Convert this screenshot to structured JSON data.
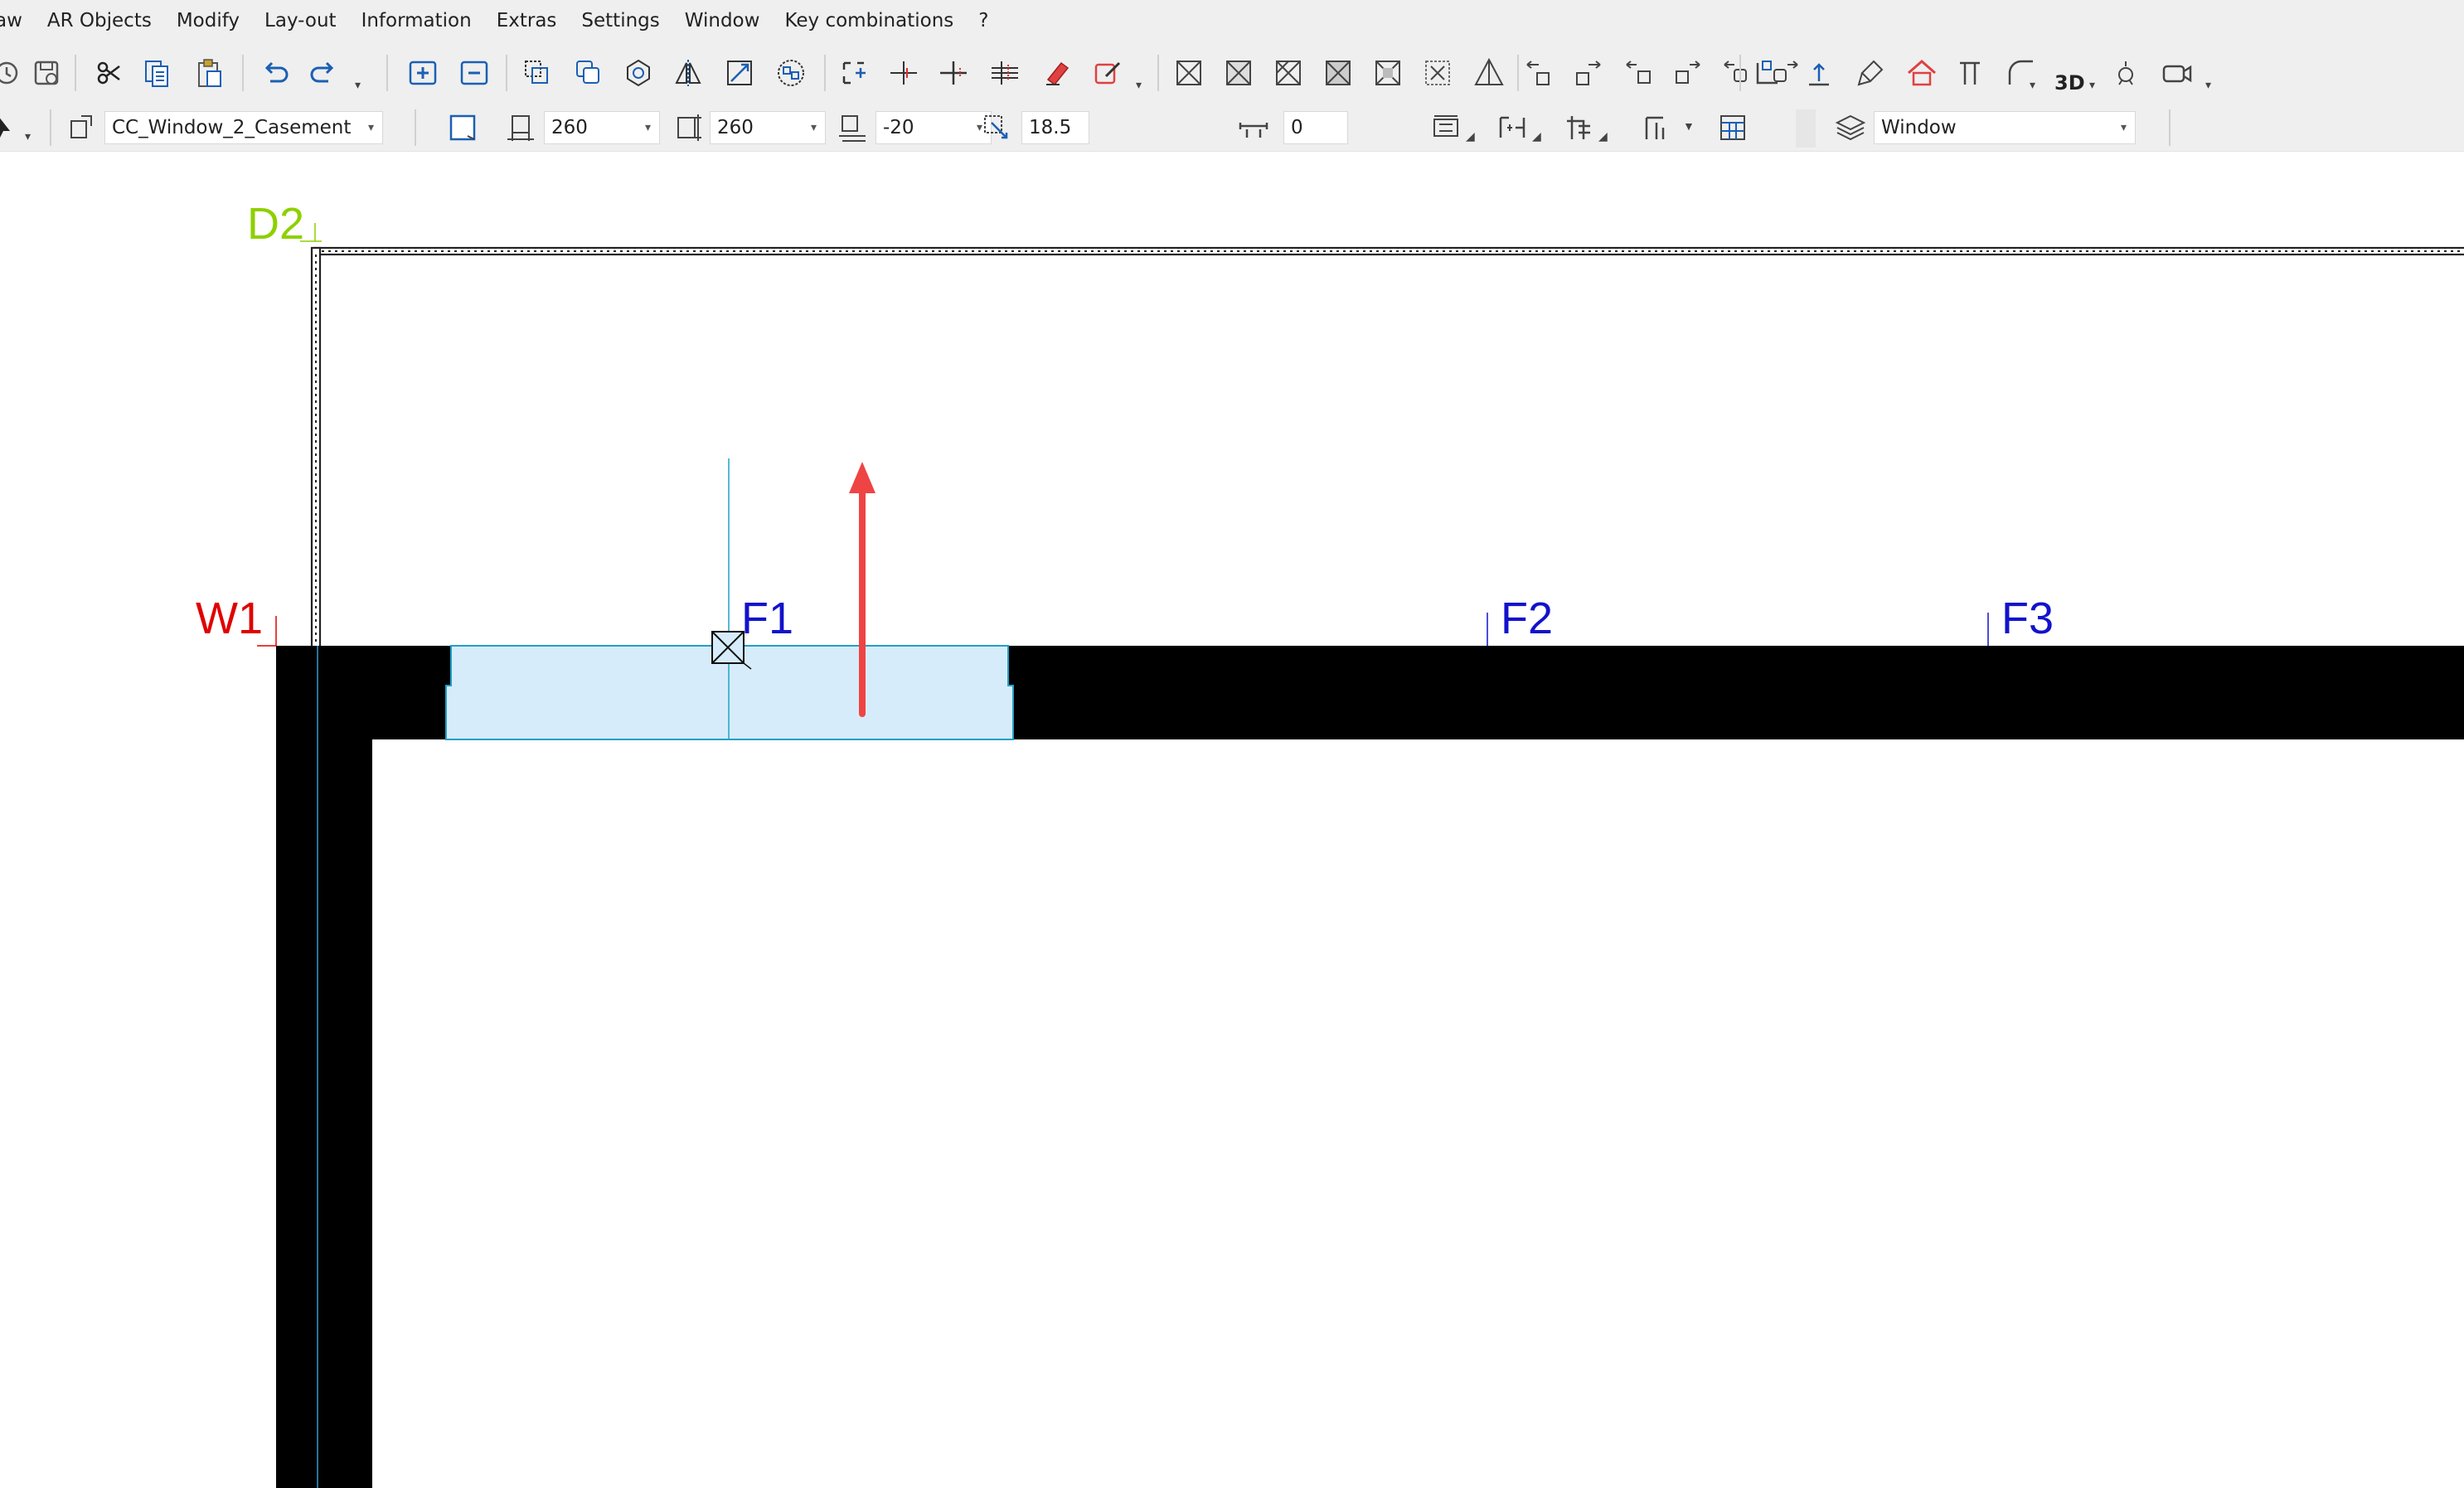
{
  "menu": [
    "aw",
    "AR Objects",
    "Modify",
    "Lay-out",
    "Information",
    "Extras",
    "Settings",
    "Window",
    "Key combinations",
    "?"
  ],
  "toolbar": {
    "element_name": "CC_Window_2_Casement",
    "width_value": "260",
    "height_value": "260",
    "sill_value": "-20",
    "angle_value": "18.5",
    "offset_value": "0",
    "layer_value": "Window",
    "view_3d_label": "3D"
  },
  "drawing": {
    "labels": {
      "d2": "D2",
      "w1": "W1",
      "f1": "F1",
      "f2": "F2",
      "f3": "F3"
    },
    "colors": {
      "d2": "#8ed000",
      "w1": "#e00000",
      "f_labels": "#1212cc",
      "wall": "#000000",
      "window_fill": "#d6ecfa",
      "window_stroke": "#22a0c8",
      "direction_arrow": "#ee4444",
      "axis_line": "#3399cc"
    }
  },
  "icons": {
    "file": [
      "redraw-icon",
      "save-icon"
    ],
    "edit": [
      "cut-icon",
      "copy-icon",
      "paste-icon",
      "undo-icon",
      "redo-icon"
    ],
    "selection": [
      "add-selection-icon",
      "subtract-selection-icon"
    ],
    "transform": [
      "duplicate-icon",
      "copy-multiple-icon",
      "rotate-icon",
      "mirror-icon",
      "scale-icon",
      "group-icon"
    ],
    "snap": [
      "snap-frame-icon",
      "snap-cross-icon",
      "snap-plus-icon",
      "snap-grid-icon",
      "eraser-icon",
      "edit-pencil-icon"
    ],
    "window_types": [
      "window-type-1-icon",
      "window-type-2-icon",
      "window-type-3-icon",
      "window-type-4-icon",
      "window-type-5-icon",
      "window-type-6-icon",
      "pyramid-icon"
    ],
    "window_moves": [
      "move-window-left-icon",
      "move-window-right-icon",
      "move-window-down-icon",
      "move-window-up-icon",
      "move-window-front-icon",
      "move-window-back-icon"
    ],
    "tools": [
      "wall-join-icon",
      "height-icon",
      "paint-brush-icon",
      "house-icon",
      "column-icon",
      "arc-icon",
      "view-3d-icon",
      "light-icon",
      "camera-icon"
    ],
    "properties": [
      "pointer-icon",
      "object-change-icon",
      "frame-icon",
      "width-icon",
      "height-icon",
      "sill-icon",
      "angle-icon",
      "offset-icon",
      "place-top-icon",
      "place-bottom-icon",
      "tool-icon",
      "grid-icon",
      "layers-icon"
    ]
  }
}
